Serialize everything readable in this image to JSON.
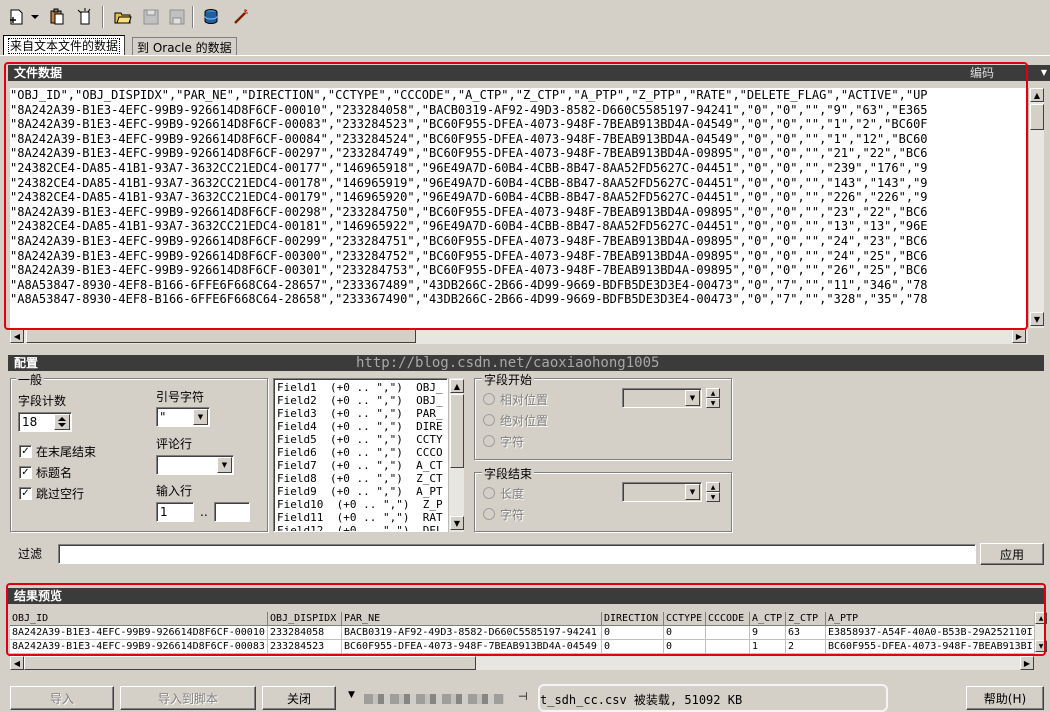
{
  "tabs": [
    "来自文本文件的数据",
    "到 Oracle 的数据"
  ],
  "file_data": {
    "title": "文件数据",
    "encoding_label": "编码",
    "lines": [
      "\"OBJ_ID\",\"OBJ_DISPIDX\",\"PAR_NE\",\"DIRECTION\",\"CCTYPE\",\"CCCODE\",\"A_CTP\",\"Z_CTP\",\"A_PTP\",\"Z_PTP\",\"RATE\",\"DELETE_FLAG\",\"ACTIVE\",\"UP",
      "\"8A242A39-B1E3-4EFC-99B9-926614D8F6CF-00010\",\"233284058\",\"BACB0319-AF92-49D3-8582-D660C5585197-94241\",\"0\",\"0\",\"\",\"9\",\"63\",\"E365",
      "\"8A242A39-B1E3-4EFC-99B9-926614D8F6CF-00083\",\"233284523\",\"BC60F955-DFEA-4073-948F-7BEAB913BD4A-04549\",\"0\",\"0\",\"\",\"1\",\"2\",\"BC60F",
      "\"8A242A39-B1E3-4EFC-99B9-926614D8F6CF-00084\",\"233284524\",\"BC60F955-DFEA-4073-948F-7BEAB913BD4A-04549\",\"0\",\"0\",\"\",\"1\",\"12\",\"BC60",
      "\"8A242A39-B1E3-4EFC-99B9-926614D8F6CF-00297\",\"233284749\",\"BC60F955-DFEA-4073-948F-7BEAB913BD4A-09895\",\"0\",\"0\",\"\",\"21\",\"22\",\"BC6",
      "\"24382CE4-DA85-41B1-93A7-3632CC21EDC4-00177\",\"146965918\",\"96E49A7D-60B4-4CBB-8B47-8AA52FD5627C-04451\",\"0\",\"0\",\"\",\"239\",\"176\",\"9",
      "\"24382CE4-DA85-41B1-93A7-3632CC21EDC4-00178\",\"146965919\",\"96E49A7D-60B4-4CBB-8B47-8AA52FD5627C-04451\",\"0\",\"0\",\"\",\"143\",\"143\",\"9",
      "\"24382CE4-DA85-41B1-93A7-3632CC21EDC4-00179\",\"146965920\",\"96E49A7D-60B4-4CBB-8B47-8AA52FD5627C-04451\",\"0\",\"0\",\"\",\"226\",\"226\",\"9",
      "\"8A242A39-B1E3-4EFC-99B9-926614D8F6CF-00298\",\"233284750\",\"BC60F955-DFEA-4073-948F-7BEAB913BD4A-09895\",\"0\",\"0\",\"\",\"23\",\"22\",\"BC6",
      "\"24382CE4-DA85-41B1-93A7-3632CC21EDC4-00181\",\"146965922\",\"96E49A7D-60B4-4CBB-8B47-8AA52FD5627C-04451\",\"0\",\"0\",\"\",\"13\",\"13\",\"96E",
      "\"8A242A39-B1E3-4EFC-99B9-926614D8F6CF-00299\",\"233284751\",\"BC60F955-DFEA-4073-948F-7BEAB913BD4A-09895\",\"0\",\"0\",\"\",\"24\",\"23\",\"BC6",
      "\"8A242A39-B1E3-4EFC-99B9-926614D8F6CF-00300\",\"233284752\",\"BC60F955-DFEA-4073-948F-7BEAB913BD4A-09895\",\"0\",\"0\",\"\",\"24\",\"25\",\"BC6",
      "\"8A242A39-B1E3-4EFC-99B9-926614D8F6CF-00301\",\"233284753\",\"BC60F955-DFEA-4073-948F-7BEAB913BD4A-09895\",\"0\",\"0\",\"\",\"26\",\"25\",\"BC6",
      "\"A8A53847-8930-4EF8-B166-6FFE6F668C64-28657\",\"233367489\",\"43DB266C-2B66-4D99-9669-BDFB5DE3D3E4-00473\",\"0\",\"7\",\"\",\"11\",\"346\",\"78",
      "\"A8A53847-8930-4EF8-B166-6FFE6F668C64-28658\",\"233367490\",\"43DB266C-2B66-4D99-9669-BDFB5DE3D3E4-00473\",\"0\",\"7\",\"\",\"328\",\"35\",\"78"
    ]
  },
  "config": {
    "title": "配置",
    "watermark": "http://blog.csdn.net/caoxiaohong1005",
    "general": {
      "title": "一般",
      "field_count_label": "字段计数",
      "field_count_value": "18",
      "checkbox_end_of_line": "在末尾结束",
      "checkbox_header": "标题名",
      "checkbox_skip_blank": "跳过空行",
      "quote_label": "引号字符",
      "quote_value": "\"",
      "comment_label": "评论行",
      "comment_value": "",
      "input_row_label": "输入行",
      "input_row_from": "1",
      "input_row_sep": "..",
      "input_row_to": ""
    },
    "fields": [
      "Field1  (+0 .. \",\")  OBJ_",
      "Field2  (+0 .. \",\")  OBJ_",
      "Field3  (+0 .. \",\")  PAR_",
      "Field4  (+0 .. \",\")  DIRE",
      "Field5  (+0 .. \",\")  CCTY",
      "Field6  (+0 .. \",\")  CCCO",
      "Field7  (+0 .. \",\")  A_CT",
      "Field8  (+0 .. \",\")  Z_CT",
      "Field9  (+0 .. \",\")  A_PT",
      "Field10  (+0 .. \",\")  Z_P",
      "Field11  (+0 .. \",\")  RAT",
      "Field12  (+0 .. \",\")  DEL"
    ],
    "field_start": {
      "title": "字段开始",
      "relative": "相对位置",
      "absolute": "绝对位置",
      "character": "字符"
    },
    "field_end": {
      "title": "字段结束",
      "length": "长度",
      "character": "字符"
    },
    "filter_label": "过滤",
    "filter_value": "",
    "apply_button": "应用"
  },
  "preview": {
    "title": "结果预览",
    "columns": [
      "OBJ_ID",
      "OBJ_DISPIDX",
      "PAR_NE",
      "DIRECTION",
      "CCTYPE",
      "CCCODE",
      "A_CTP",
      "Z_CTP",
      "A_PTP"
    ],
    "rows": [
      [
        "8A242A39-B1E3-4EFC-99B9-926614D8F6CF-00010",
        "233284058",
        "BACB0319-AF92-49D3-8582-D660C5585197-94241",
        "0",
        "0",
        "",
        "9",
        "63",
        "E3858937-A54F-40A0-B53B-29A252110I"
      ],
      [
        "8A242A39-B1E3-4EFC-99B9-926614D8F6CF-00083",
        "233284523",
        "BC60F955-DFEA-4073-948F-7BEAB913BD4A-04549",
        "0",
        "0",
        "",
        "1",
        "2",
        "BC60F955-DFEA-4073-948F-7BEAB913BI"
      ]
    ]
  },
  "bottom": {
    "import_button": "导入",
    "import_script_button": "导入到脚本",
    "close_button": "关闭",
    "status_text": "t_sdh_cc.csv 被装载, 51092 KB",
    "help_button": "帮助(H)"
  },
  "colors": {
    "highlight_red": "#e00010",
    "header_bar": "#3b3b3b",
    "window_face": "#d4d0c8"
  }
}
